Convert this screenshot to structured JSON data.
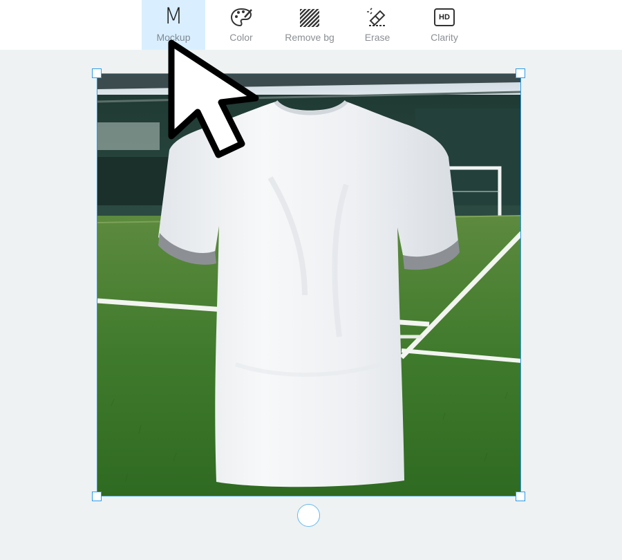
{
  "toolbar": {
    "tools": [
      {
        "label": "Mockup",
        "glyph": "M",
        "icon": "mockup-icon",
        "active": true
      },
      {
        "label": "Color",
        "icon": "palette-icon",
        "active": false
      },
      {
        "label": "Remove bg",
        "icon": "stripes-icon",
        "active": false
      },
      {
        "label": "Erase",
        "icon": "eraser-icon",
        "active": false
      },
      {
        "label": "Clarity",
        "glyph": "HD",
        "icon": "hd-icon",
        "active": false
      }
    ]
  },
  "canvas": {
    "image_subject": "white t-shirt mockup on football pitch",
    "selection_color": "#2e9be5"
  },
  "colors": {
    "active_tool_bg": "#d9efff",
    "workspace_bg": "#eef2f3"
  }
}
